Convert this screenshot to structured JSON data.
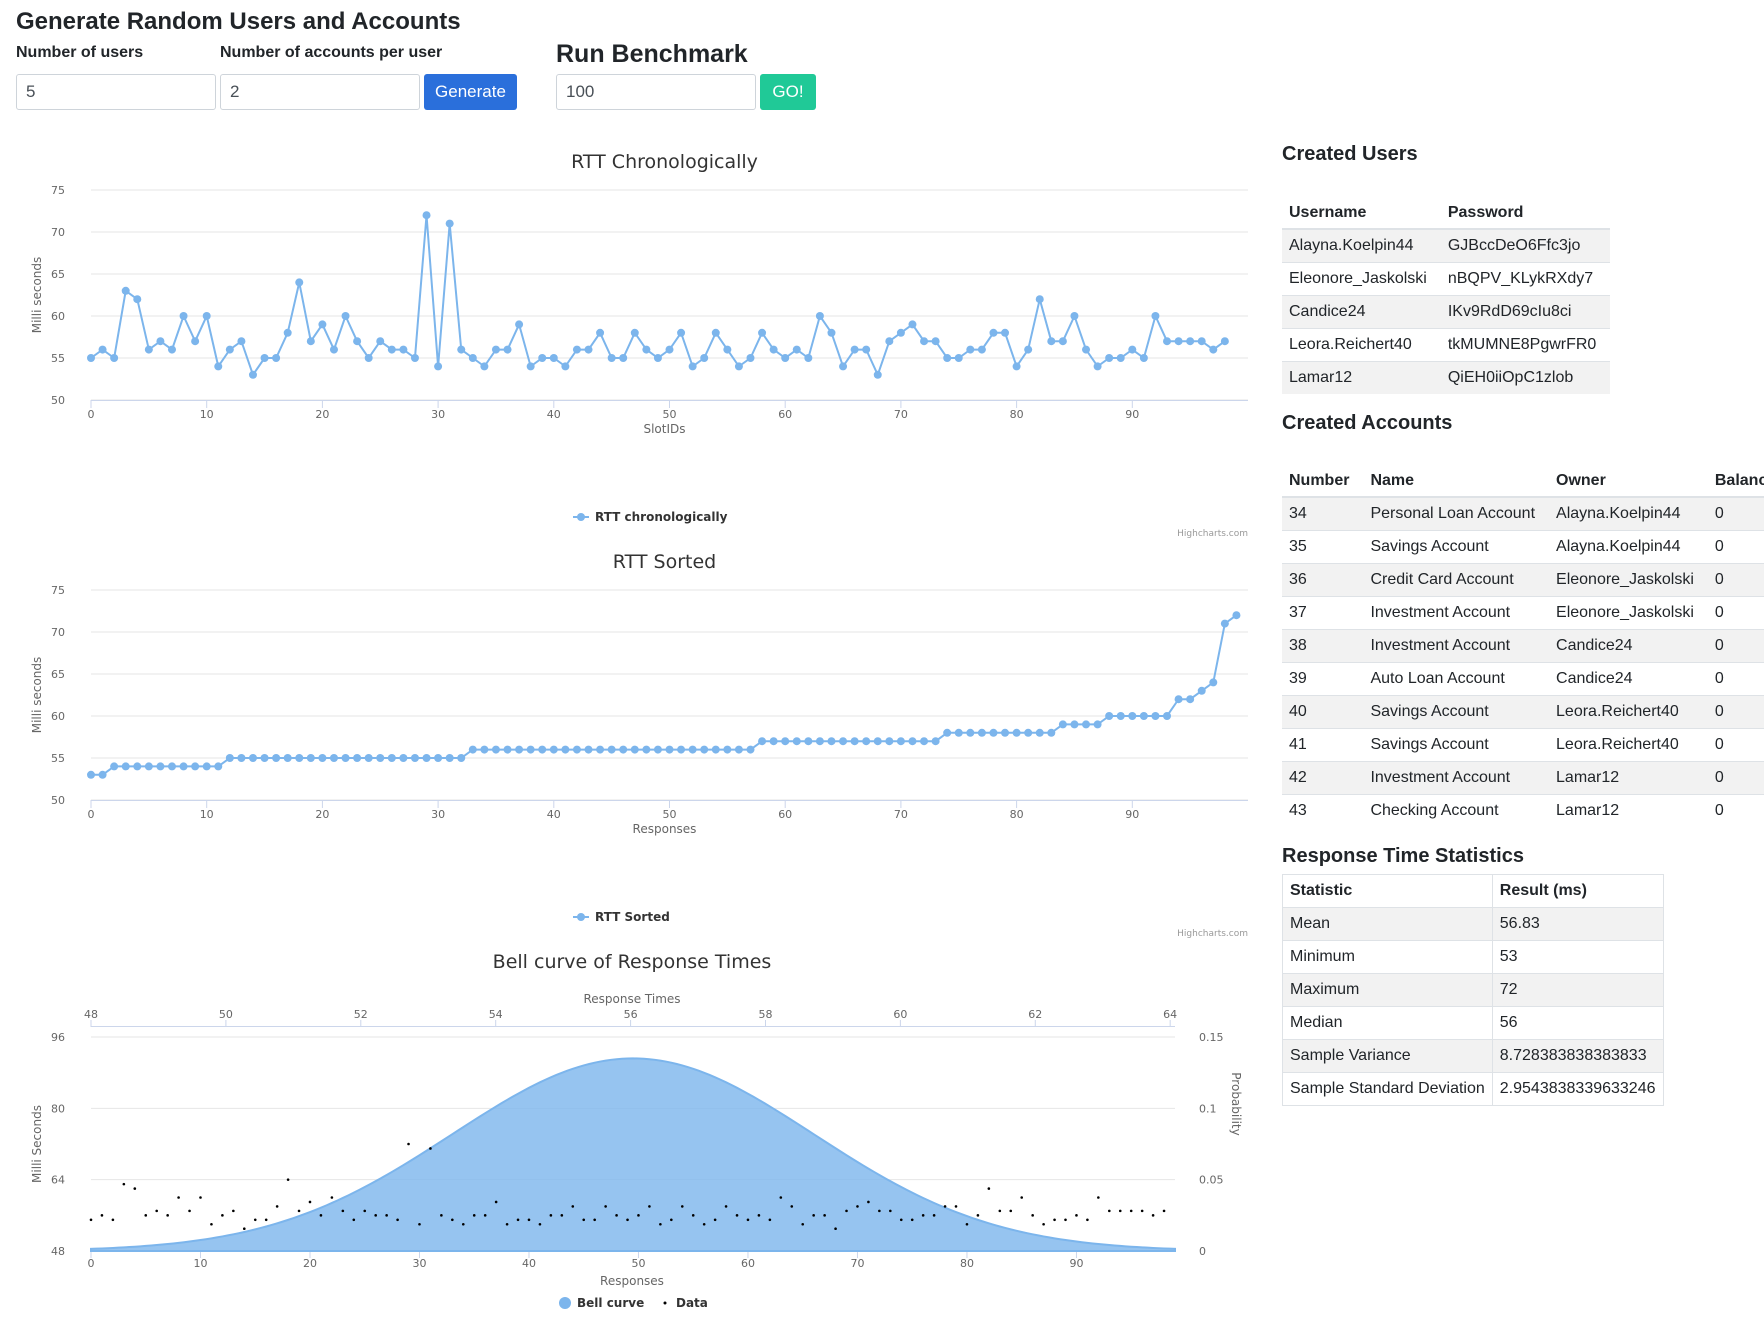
{
  "generate": {
    "title": "Generate Random Users and Accounts",
    "users_label": "Number of users",
    "users_value": "5",
    "accounts_label": "Number of accounts per user",
    "accounts_value": "2",
    "button": "Generate",
    "button_color": "#2a6fdb"
  },
  "benchmark": {
    "title": "Run Benchmark",
    "value": "100",
    "button": "GO!",
    "button_color": "#20c997"
  },
  "credits": "Highcharts.com",
  "chart_data": [
    {
      "type": "line",
      "title": "RTT Chronologically",
      "xlabel": "SlotIDs",
      "ylabel": "Milli seconds",
      "xlim": [
        0,
        99
      ],
      "ylim": [
        50,
        75
      ],
      "xticks": [
        0,
        10,
        20,
        30,
        40,
        50,
        60,
        70,
        80,
        90
      ],
      "yticks": [
        50,
        55,
        60,
        65,
        70,
        75
      ],
      "legend": "bottom-center",
      "color": "#7cb5ec",
      "series": [
        {
          "name": "RTT chronologically",
          "values": [
            55,
            56,
            55,
            63,
            62,
            56,
            57,
            56,
            60,
            57,
            60,
            54,
            56,
            57,
            53,
            55,
            55,
            58,
            64,
            57,
            59,
            56,
            60,
            57,
            55,
            57,
            56,
            56,
            55,
            72,
            54,
            71,
            56,
            55,
            54,
            56,
            56,
            59,
            54,
            55,
            55,
            54,
            56,
            56,
            58,
            55,
            55,
            58,
            56,
            55,
            56,
            58,
            54,
            55,
            58,
            56,
            54,
            55,
            58,
            56,
            55,
            56,
            55,
            60,
            58,
            54,
            56,
            56,
            53,
            57,
            58,
            59,
            57,
            57,
            55,
            55,
            56,
            56,
            58,
            58,
            54,
            56,
            62,
            57,
            57,
            60,
            56,
            54,
            55,
            55,
            56,
            55,
            60,
            57,
            57,
            57,
            57,
            56,
            57
          ]
        }
      ]
    },
    {
      "type": "line",
      "title": "RTT Sorted",
      "xlabel": "Responses",
      "ylabel": "Milli seconds",
      "xlim": [
        0,
        99
      ],
      "ylim": [
        50,
        75
      ],
      "xticks": [
        0,
        10,
        20,
        30,
        40,
        50,
        60,
        70,
        80,
        90
      ],
      "yticks": [
        50,
        55,
        60,
        65,
        70,
        75
      ],
      "legend": "bottom-center",
      "color": "#7cb5ec",
      "series": [
        {
          "name": "RTT Sorted",
          "values": [
            53,
            53,
            54,
            54,
            54,
            54,
            54,
            54,
            54,
            54,
            54,
            54,
            55,
            55,
            55,
            55,
            55,
            55,
            55,
            55,
            55,
            55,
            55,
            55,
            55,
            55,
            55,
            55,
            55,
            55,
            55,
            55,
            55,
            56,
            56,
            56,
            56,
            56,
            56,
            56,
            56,
            56,
            56,
            56,
            56,
            56,
            56,
            56,
            56,
            56,
            56,
            56,
            56,
            56,
            56,
            56,
            56,
            56,
            57,
            57,
            57,
            57,
            57,
            57,
            57,
            57,
            57,
            57,
            57,
            57,
            57,
            57,
            57,
            57,
            58,
            58,
            58,
            58,
            58,
            58,
            58,
            58,
            58,
            58,
            59,
            59,
            59,
            59,
            60,
            60,
            60,
            60,
            60,
            60,
            62,
            62,
            63,
            64,
            71,
            72
          ]
        }
      ]
    },
    {
      "type": "area",
      "title": "Bell curve of Response Times",
      "xlabel": "Responses",
      "x2label": "Response Times",
      "ylabel": "Milli Seconds",
      "y2label": "Probability",
      "xlim": [
        0,
        99
      ],
      "xticks": [
        0,
        10,
        20,
        30,
        40,
        50,
        60,
        70,
        80,
        90
      ],
      "x2lim": [
        48,
        66
      ],
      "x2ticks": [
        48,
        50,
        52,
        54,
        56,
        58,
        60,
        62,
        64
      ],
      "ylim": [
        48,
        96
      ],
      "yticks": [
        48,
        64,
        80,
        96
      ],
      "y2lim": [
        0,
        0.15
      ],
      "y2ticks": [
        0,
        0.05,
        0.1,
        0.15
      ],
      "legend": "bottom-center",
      "series": [
        {
          "name": "Bell curve",
          "mean": 56.83,
          "std": 2.954,
          "color": "#7cb5ec"
        },
        {
          "name": "Data",
          "values": [
            55,
            56,
            55,
            63,
            62,
            56,
            57,
            56,
            60,
            57,
            60,
            54,
            56,
            57,
            53,
            55,
            55,
            58,
            64,
            57,
            59,
            56,
            60,
            57,
            55,
            57,
            56,
            56,
            55,
            72,
            54,
            71,
            56,
            55,
            54,
            56,
            56,
            59,
            54,
            55,
            55,
            54,
            56,
            56,
            58,
            55,
            55,
            58,
            56,
            55,
            56,
            58,
            54,
            55,
            58,
            56,
            54,
            55,
            58,
            56,
            55,
            56,
            55,
            60,
            58,
            54,
            56,
            56,
            53,
            57,
            58,
            59,
            57,
            57,
            55,
            55,
            56,
            56,
            58,
            58,
            54,
            56,
            62,
            57,
            57,
            60,
            56,
            54,
            55,
            55,
            56,
            55,
            60,
            57,
            57,
            57,
            57,
            56,
            57
          ],
          "color": "#000000"
        }
      ]
    }
  ],
  "users": {
    "title": "Created Users",
    "headers": [
      "Username",
      "Password"
    ],
    "rows": [
      [
        "Alayna.Koelpin44",
        "GJBccDeO6Ffc3jo"
      ],
      [
        "Eleonore_Jaskolski",
        "nBQPV_KLykRXdy7"
      ],
      [
        "Candice24",
        "IKv9RdD69cIu8ci"
      ],
      [
        "Leora.Reichert40",
        "tkMUMNE8PgwrFR0"
      ],
      [
        "Lamar12",
        "QiEH0iiOpC1zlob"
      ]
    ]
  },
  "accounts": {
    "title": "Created Accounts",
    "headers": [
      "Number",
      "Name",
      "Owner",
      "Balance"
    ],
    "rows": [
      [
        "34",
        "Personal Loan Account",
        "Alayna.Koelpin44",
        "0"
      ],
      [
        "35",
        "Savings Account",
        "Alayna.Koelpin44",
        "0"
      ],
      [
        "36",
        "Credit Card Account",
        "Eleonore_Jaskolski",
        "0"
      ],
      [
        "37",
        "Investment Account",
        "Eleonore_Jaskolski",
        "0"
      ],
      [
        "38",
        "Investment Account",
        "Candice24",
        "0"
      ],
      [
        "39",
        "Auto Loan Account",
        "Candice24",
        "0"
      ],
      [
        "40",
        "Savings Account",
        "Leora.Reichert40",
        "0"
      ],
      [
        "41",
        "Savings Account",
        "Leora.Reichert40",
        "0"
      ],
      [
        "42",
        "Investment Account",
        "Lamar12",
        "0"
      ],
      [
        "43",
        "Checking Account",
        "Lamar12",
        "0"
      ]
    ]
  },
  "stats": {
    "title": "Response Time Statistics",
    "headers": [
      "Statistic",
      "Result (ms)"
    ],
    "rows": [
      [
        "Mean",
        "56.83"
      ],
      [
        "Minimum",
        "53"
      ],
      [
        "Maximum",
        "72"
      ],
      [
        "Median",
        "56"
      ],
      [
        "Sample Variance",
        "8.728383838383833"
      ],
      [
        "Sample Standard Deviation",
        "2.9543838339633246"
      ]
    ]
  }
}
